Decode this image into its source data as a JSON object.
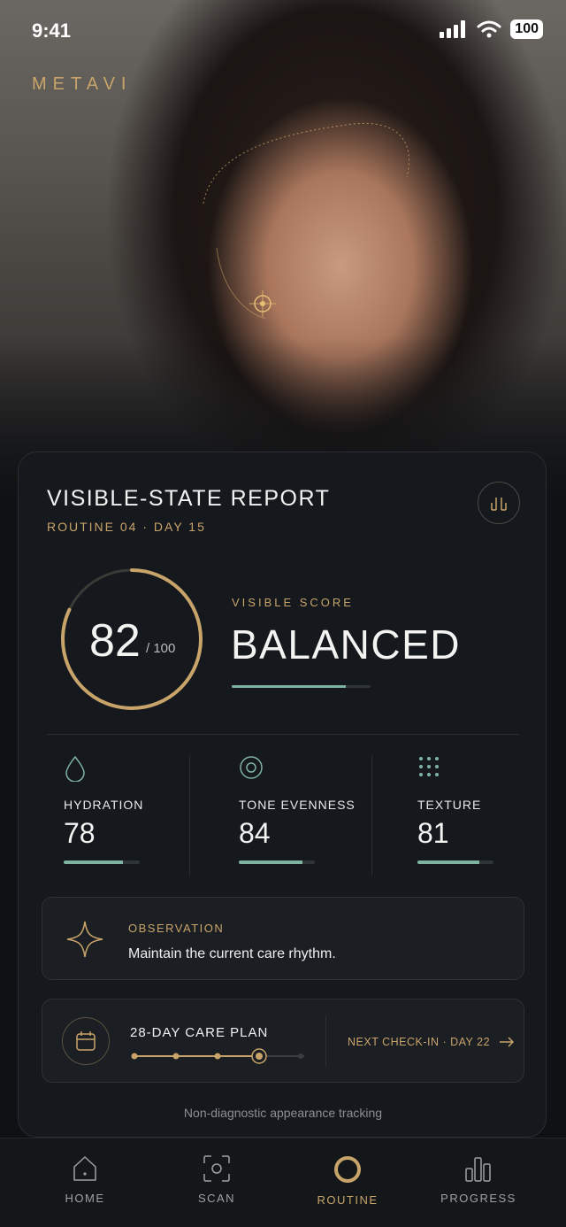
{
  "status_bar": {
    "time": "9:41",
    "battery": "100",
    "icons": [
      "signal-icon",
      "wifi-icon",
      "battery-icon"
    ]
  },
  "brand": {
    "name": "METAVI"
  },
  "hero": {
    "image": "portrait-photo"
  },
  "report": {
    "title": "VISIBLE-STATE REPORT",
    "subtitle": "ROUTINE 04 · DAY 15",
    "score": "82",
    "score_total": "/ 100",
    "score_fraction": 0.82,
    "visible_score_label": "VISIBLE SCORE",
    "visible_score_value": "BALANCED"
  },
  "metrics": [
    {
      "label": "HYDRATION",
      "value": "78",
      "fraction": 0.78,
      "icon": "water-drop-icon"
    },
    {
      "label": "TONE EVENNESS",
      "value": "84",
      "fraction": 0.84,
      "icon": "target-circle-icon"
    },
    {
      "label": "TEXTURE",
      "value": "81",
      "fraction": 0.81,
      "icon": "dot-grid-icon"
    }
  ],
  "observation": {
    "label": "OBSERVATION",
    "text": "Maintain the current care rhythm.",
    "icon": "sparkle-icon"
  },
  "care_plan": {
    "title": "28-DAY CARE PLAN",
    "next_checkin": "NEXT CHECK-IN · DAY 22",
    "icon": "calendar-icon",
    "steps_total": 5,
    "current_step": 4
  },
  "footnote": "Non-diagnostic appearance tracking",
  "tabs": [
    {
      "label": "HOME",
      "icon": "home-icon",
      "active": false
    },
    {
      "label": "SCAN",
      "icon": "scan-icon",
      "active": false
    },
    {
      "label": "ROUTINE",
      "icon": "routine-ring-icon",
      "active": true
    },
    {
      "label": "PROGRESS",
      "icon": "bar-chart-icon",
      "active": false
    }
  ],
  "colors": {
    "accent_gold": "#c9a46a",
    "accent_teal": "#7fb3a1",
    "card_bg": "#15181c",
    "page_bg": "#0f1114"
  }
}
